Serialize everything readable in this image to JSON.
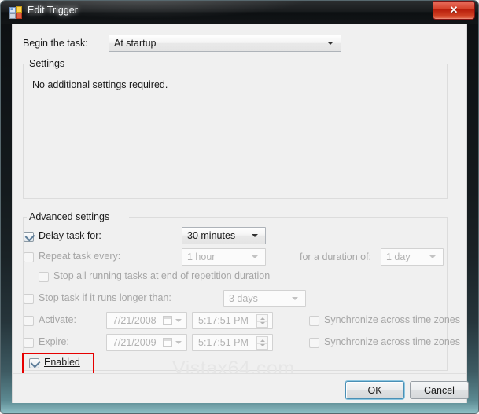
{
  "window": {
    "title": "Edit Trigger",
    "icon": "task-scheduler-icon",
    "close_label": "✕"
  },
  "begin": {
    "label": "Begin the task:",
    "value": "At startup"
  },
  "settings_group": {
    "legend": "Settings",
    "message": "No additional settings required."
  },
  "advanced_group": {
    "legend": "Advanced settings",
    "rows": {
      "delay": {
        "label": "Delay task for:",
        "checked": true,
        "value": "30 minutes"
      },
      "repeat": {
        "label": "Repeat task every:",
        "checked": false,
        "value": "1 hour",
        "duration_label": "for a duration of:",
        "duration_value": "1 day"
      },
      "stop_all": {
        "label": "Stop all running tasks at end of repetition duration",
        "checked": false
      },
      "stop_longer": {
        "label": "Stop task if it runs longer than:",
        "checked": false,
        "value": "3 days"
      },
      "activate": {
        "label": "Activate:",
        "checked": false,
        "date": "7/21/2008",
        "time": "5:17:51 PM",
        "sync_label": "Synchronize across time zones",
        "sync_checked": false
      },
      "expire": {
        "label": "Expire:",
        "checked": false,
        "date": "7/21/2009",
        "time": "5:17:51 PM",
        "sync_label": "Synchronize across time zones",
        "sync_checked": false
      },
      "enabled": {
        "label": "Enabled",
        "checked": true,
        "highlighted": true
      }
    }
  },
  "footer": {
    "ok_label": "OK",
    "cancel_label": "Cancel"
  },
  "watermark": {
    "text": "Vistax64.com"
  },
  "colors": {
    "accent": "#4a8fb5",
    "annotation": "#e60000",
    "disabled_text": "#a6a6a6",
    "text": "#1a1a1a",
    "close_button": "#b81e0c"
  }
}
